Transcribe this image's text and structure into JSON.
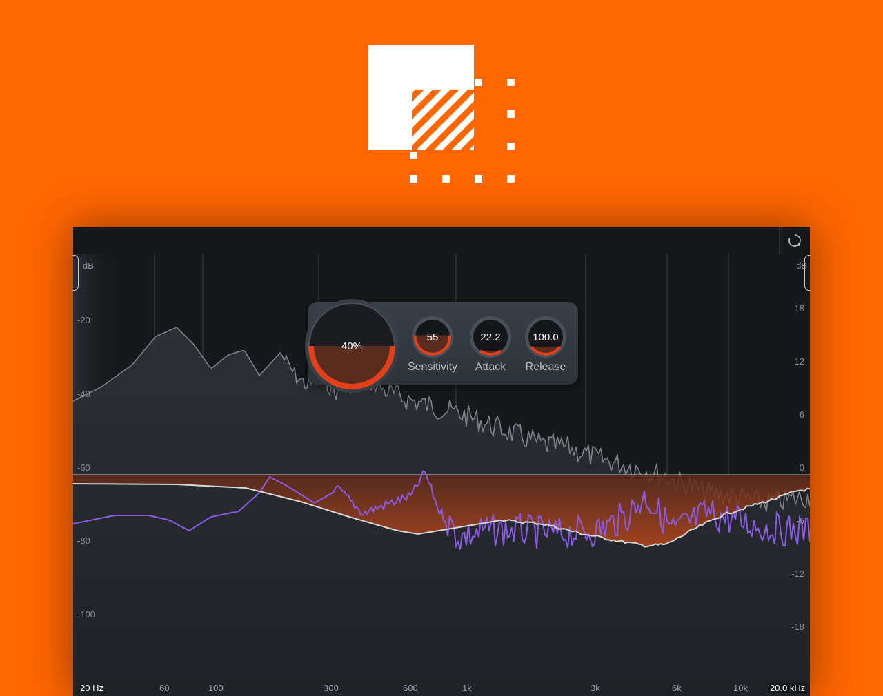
{
  "app": {
    "accent": "#ff6600",
    "logo_icon": "product-logo-icon",
    "reset_icon": "refresh-icon"
  },
  "controls": {
    "amount": {
      "value_label": "40%",
      "fraction": 0.4
    },
    "knobs": [
      {
        "label": "Sensitivity",
        "value": "55",
        "fraction": 0.55
      },
      {
        "label": "Attack",
        "value": "22.2",
        "fraction": 0.1
      },
      {
        "label": "Release",
        "value": "100.0",
        "fraction": 0.22
      }
    ]
  },
  "axes": {
    "left_unit": "dB",
    "right_unit": "dB",
    "left_ticks": [
      "-20",
      "-40",
      "-60",
      "-80",
      "-100"
    ],
    "right_ticks": [
      "18",
      "12",
      "6",
      "0",
      "-6",
      "-12",
      "-18"
    ],
    "freq_ticks": [
      "20 Hz",
      "60",
      "100",
      "300",
      "600",
      "1k",
      "3k",
      "6k",
      "10k",
      "20.0 kHz"
    ]
  },
  "colors": {
    "spectrum_gray": "#7e8389",
    "target_purple": "#8a5ce6",
    "curve_white": "#d8d8d8",
    "fill_orange": "#b8481c"
  }
}
